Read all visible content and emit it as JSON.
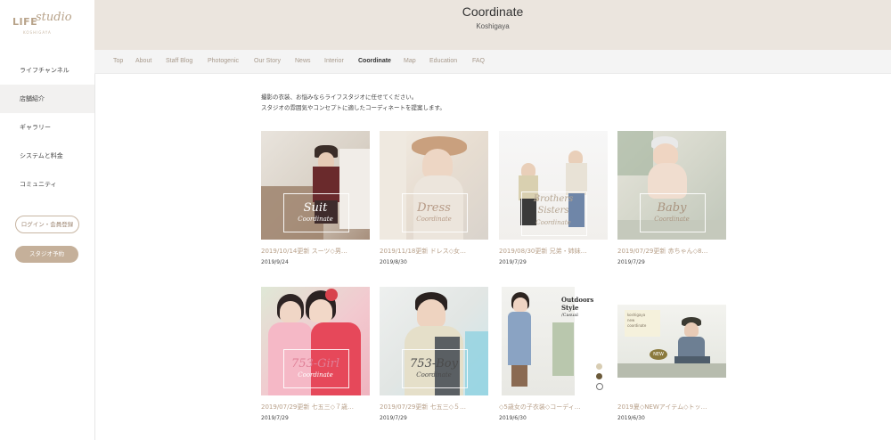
{
  "logo": {
    "word": "LIFE",
    "script": "studio",
    "sub": "KOSHIGAYA"
  },
  "sidebar": {
    "items": [
      {
        "label": "ライフチャンネル"
      },
      {
        "label": "店舗紹介"
      },
      {
        "label": "ギャラリー"
      },
      {
        "label": "システムと料金"
      },
      {
        "label": "コミュニティ"
      }
    ],
    "login_label": "ログイン・会員登録",
    "book_label": "スタジオ予約"
  },
  "header": {
    "title": "Coordinate",
    "subtitle": "Koshigaya"
  },
  "tabs": [
    {
      "label": "Top"
    },
    {
      "label": "About"
    },
    {
      "label": "Staff Blog"
    },
    {
      "label": "Photogenic"
    },
    {
      "label": "Our Story"
    },
    {
      "label": "News"
    },
    {
      "label": "Interior"
    },
    {
      "label": "Coordinate"
    },
    {
      "label": "Map"
    },
    {
      "label": "Education"
    },
    {
      "label": "FAQ"
    }
  ],
  "intro": {
    "line1": "撮影の衣装、お悩みならライフスタジオに任せてください。",
    "line2": "スタジオの雰囲気やコンセプトに適したコーディネートを提案します。"
  },
  "cards": [
    {
      "title": "2019/10/14更新 スーツ◇男…",
      "date": "2019/9/24",
      "overlay1": "Suit",
      "overlay2": "Coordinate"
    },
    {
      "title": "2019/11/18更新 ドレス◇女…",
      "date": "2019/8/30",
      "overlay1": "Dress",
      "overlay2": "Coordinate"
    },
    {
      "title": "2019/08/30更新 兄弟・姉妹…",
      "date": "2019/7/29",
      "overlay1": "Brothers",
      "overlay2": "Sisters",
      "overlay3": "Coordinate"
    },
    {
      "title": "2019/07/29更新 赤ちゃん◇8…",
      "date": "2019/7/29",
      "overlay1": "Baby",
      "overlay2": "Coordinate"
    },
    {
      "title": "2019/07/29更新 七五三◇７歳…",
      "date": "2019/7/29",
      "overlay1": "753-Girl",
      "overlay2": "Coordinate"
    },
    {
      "title": "2019/07/29更新 七五三◇５…",
      "date": "2019/7/29",
      "overlay1": "753-Boy",
      "overlay2": "Coordinate"
    },
    {
      "title": "◇5歳女の子衣装◇コーディ…",
      "date": "2019/6/30",
      "overlay1": "Outdoors",
      "overlay2": "Style",
      "overlay3": "/Casual"
    },
    {
      "title": "2019夏◇NEWアイテム◇トッ…",
      "date": "2019/6/30",
      "overlay1": "koshigaya",
      "overlay2": "new",
      "overlay3": "coordinate",
      "badge": "NEW"
    }
  ],
  "colors": {
    "accent": "#c5b09a",
    "header_bg": "#ebe5de",
    "title_link": "#b79f88"
  }
}
